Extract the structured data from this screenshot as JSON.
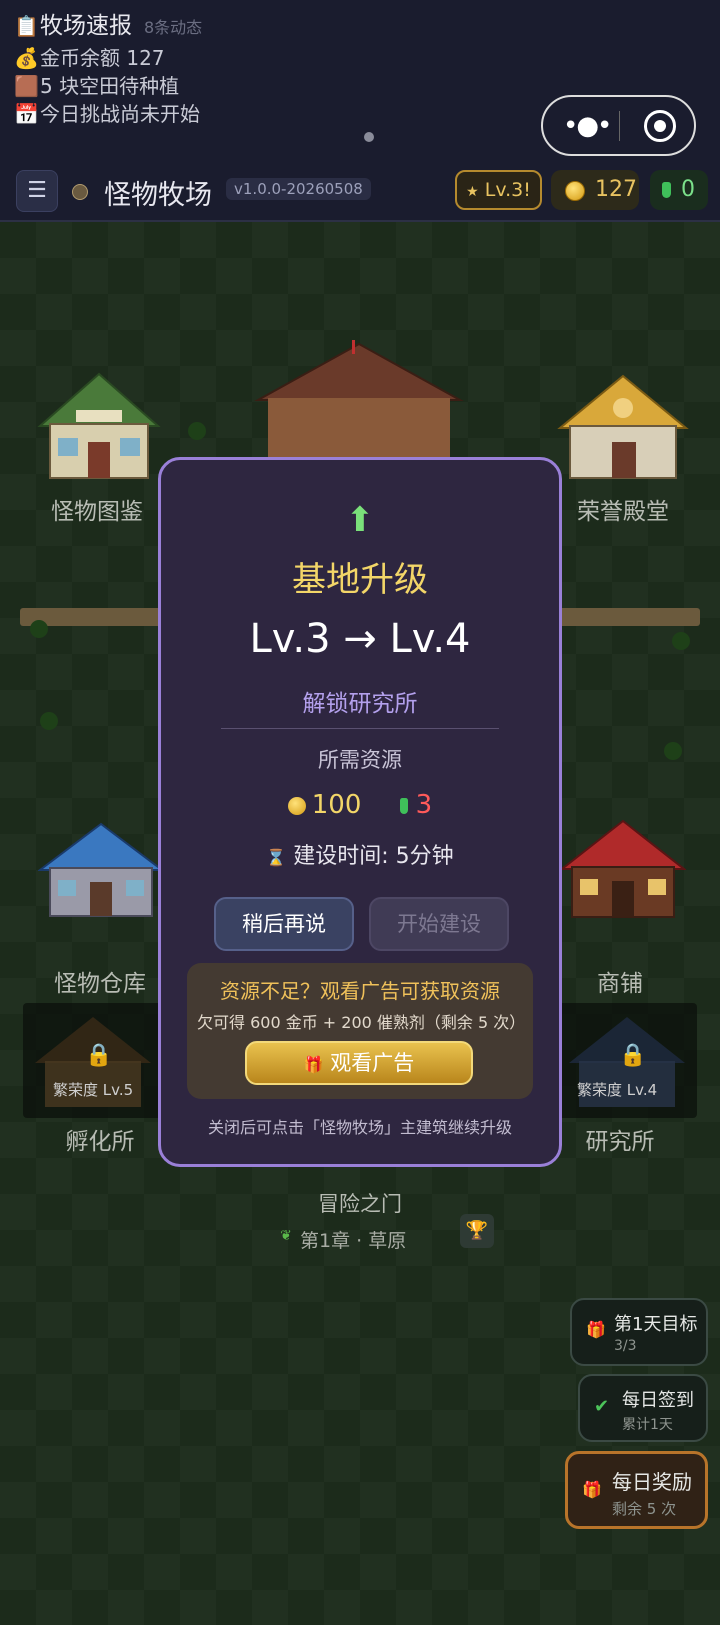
{
  "news": {
    "title": "牧场速报",
    "sub": "8条动态",
    "lines": [
      {
        "icon": "💰",
        "text": "金币余额 127"
      },
      {
        "icon": "🟫",
        "text": "5 块空田待种植"
      },
      {
        "icon": "📅",
        "text": "今日挑战尚未开始"
      }
    ]
  },
  "header": {
    "menu_icon": "☰",
    "title": "怪物牧场",
    "version": "v1.0.0-20260508",
    "level": "Lv.3",
    "level_alert": "!",
    "coins": "127",
    "potions": "0"
  },
  "map": {
    "buildings": {
      "monster_book": "怪物图鉴",
      "hall_of_honor": "荣誉殿堂",
      "monster_storage": "怪物仓库",
      "shop": "商铺",
      "hatchery": "孵化所",
      "research": "研究所",
      "adventure": "冒险之门"
    },
    "hatchery_lock": "繁荣度 Lv.5",
    "research_lock": "繁荣度 Lv.4",
    "adventure_chapter": "第1章 · 草原"
  },
  "side": {
    "day_goal_title": "第1天目标",
    "day_goal_progress": "3/3",
    "checkin_title": "每日签到",
    "checkin_sub": "累计1天",
    "reward_title": "每日奖励",
    "reward_sub": "剩余 5 次"
  },
  "modal": {
    "title": "基地升级",
    "levels": "Lv.3 → Lv.4",
    "unlock": "解锁研究所",
    "resources_label": "所需资源",
    "coin_cost": "100",
    "potion_cost": "3",
    "build_time": "建设时间: 5分钟",
    "later_button": "稍后再说",
    "build_button": "开始建设",
    "ad_title": "资源不足？观看广告可获取资源",
    "ad_reward": "欠可得 600 金币 + 200 催熟剂（剩余 5 次）",
    "ad_button": "观看广告",
    "hint": "关闭后可点击「怪物牧场」主建筑继续升级"
  },
  "colors": {
    "modal_bg": "#2e2640",
    "modal_border": "#9a80d8",
    "title_gold": "#f3d668",
    "potion_red": "#ff5a5a"
  }
}
